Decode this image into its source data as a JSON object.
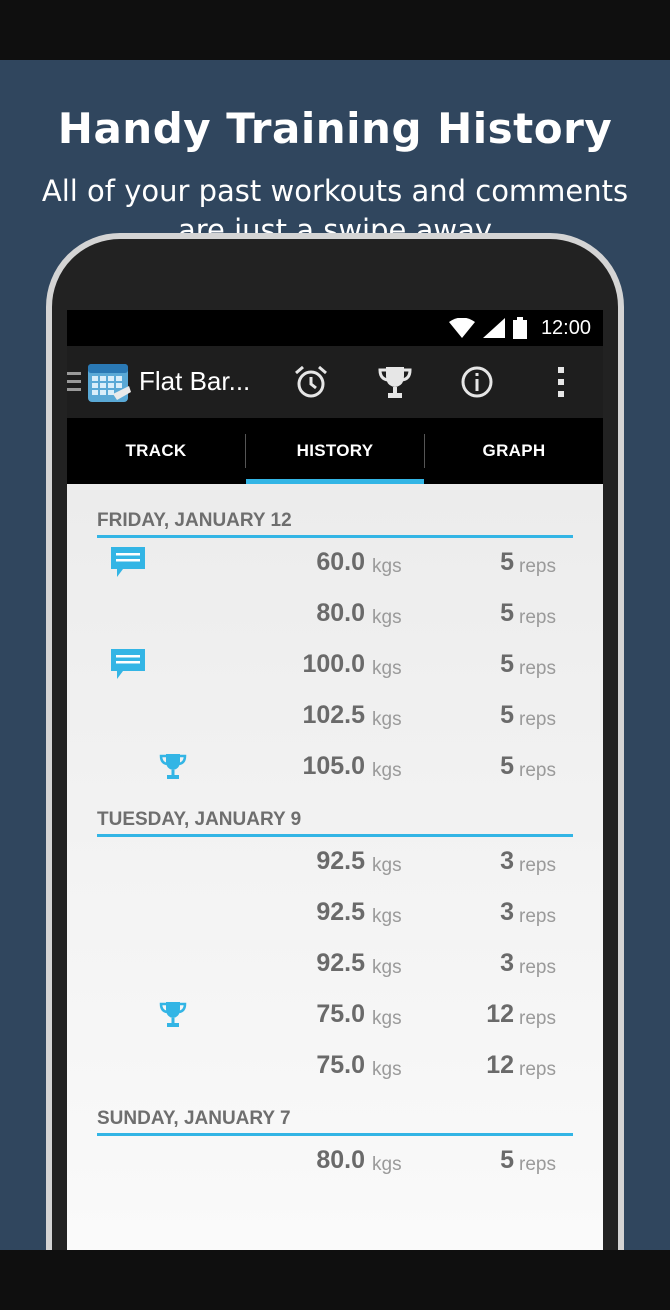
{
  "promo": {
    "headline": "Handy Training History",
    "subline_1": "All of your past workouts and comments",
    "subline_2": "are just a swipe away"
  },
  "status_bar": {
    "time": "12:00"
  },
  "app_bar": {
    "title": "Flat Bar...",
    "actions": [
      "alarm-icon",
      "trophy-icon",
      "info-icon",
      "overflow-menu-icon"
    ]
  },
  "tabs": [
    {
      "label": "TRACK",
      "active": false
    },
    {
      "label": "HISTORY",
      "active": true
    },
    {
      "label": "GRAPH",
      "active": false
    }
  ],
  "history": {
    "days": [
      {
        "label": "FRIDAY, JANUARY 12",
        "sets": [
          {
            "weight": "60.0",
            "unit": "kgs",
            "reps": "5",
            "reps_unit": "reps",
            "icon": "comment"
          },
          {
            "weight": "80.0",
            "unit": "kgs",
            "reps": "5",
            "reps_unit": "reps",
            "icon": ""
          },
          {
            "weight": "100.0",
            "unit": "kgs",
            "reps": "5",
            "reps_unit": "reps",
            "icon": "comment"
          },
          {
            "weight": "102.5",
            "unit": "kgs",
            "reps": "5",
            "reps_unit": "reps",
            "icon": ""
          },
          {
            "weight": "105.0",
            "unit": "kgs",
            "reps": "5",
            "reps_unit": "reps",
            "icon": "trophy"
          }
        ]
      },
      {
        "label": "TUESDAY, JANUARY 9",
        "sets": [
          {
            "weight": "92.5",
            "unit": "kgs",
            "reps": "3",
            "reps_unit": "reps",
            "icon": ""
          },
          {
            "weight": "92.5",
            "unit": "kgs",
            "reps": "3",
            "reps_unit": "reps",
            "icon": ""
          },
          {
            "weight": "92.5",
            "unit": "kgs",
            "reps": "3",
            "reps_unit": "reps",
            "icon": ""
          },
          {
            "weight": "75.0",
            "unit": "kgs",
            "reps": "12",
            "reps_unit": "reps",
            "icon": "trophy"
          },
          {
            "weight": "75.0",
            "unit": "kgs",
            "reps": "12",
            "reps_unit": "reps",
            "icon": ""
          }
        ]
      },
      {
        "label": "SUNDAY, JANUARY 7",
        "sets": [
          {
            "weight": "80.0",
            "unit": "kgs",
            "reps": "5",
            "reps_unit": "reps",
            "icon": ""
          }
        ]
      }
    ]
  },
  "colors": {
    "accent": "#33b5e5",
    "promo_background": "#30465e",
    "text_grey": "#6a6a6a"
  }
}
